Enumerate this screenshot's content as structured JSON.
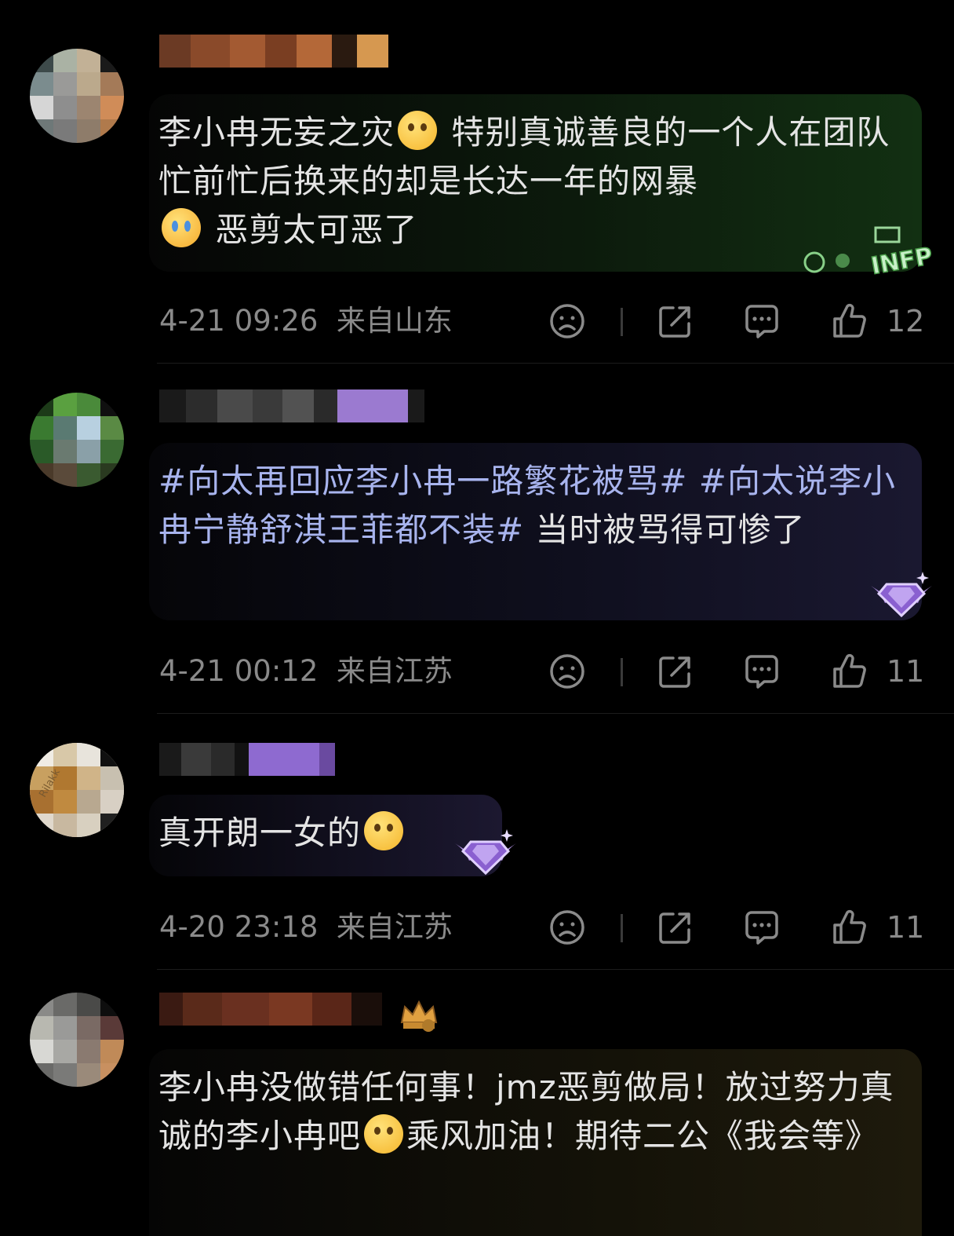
{
  "comments": [
    {
      "text_a": "李小冉无妄之灾",
      "text_b": " 特别真诚善良的一个人在团队忙前忙后换来的却是长达一年的网暴",
      "text_c": " 恶剪太可恶了",
      "badge_label": "INFP",
      "time": "4-21 09:26",
      "location": "来自山东",
      "likes": "12"
    },
    {
      "tag1": "#向太再回应李小冉一路繁花被骂#",
      "tag2": "#向太说李小冉宁静舒淇王菲都不装#",
      "text_a": " 当时被骂得可惨了",
      "time": "4-21 00:12",
      "location": "来自江苏",
      "likes": "11"
    },
    {
      "text_a": "真开朗一女的",
      "avatar_label": "Rilakk",
      "time": "4-20 23:18",
      "location": "来自江苏",
      "likes": "11"
    },
    {
      "text_a": "李小冉没做错任何事！jmz恶剪做局！放过努力真诚的李小冉吧",
      "text_b": "乘风加油！期待二公《我会等》"
    }
  ],
  "icons": {
    "dislike": "sad-face-icon",
    "share": "share-icon",
    "reply": "comment-icon",
    "like": "thumbs-up-icon"
  },
  "colors": {
    "background": "#000000",
    "text": "#e4e4e4",
    "hashtag": "#a8b4ee",
    "meta": "#8a8a8a"
  }
}
